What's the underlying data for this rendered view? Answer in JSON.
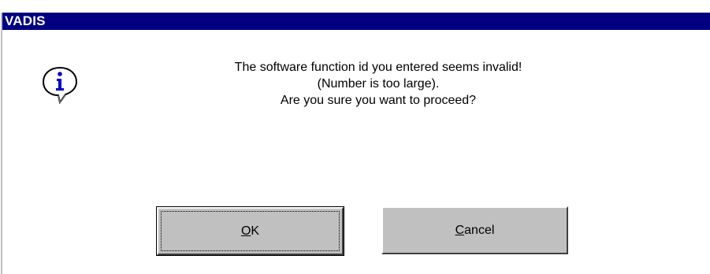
{
  "window": {
    "title": "VADIS"
  },
  "message": {
    "line1": "The software function id you entered seems invalid!",
    "line2": "(Number is too large).",
    "line3": "Are you sure you want to proceed?"
  },
  "icon": {
    "name": "info-icon",
    "glyph": "i",
    "color": "#0000c0"
  },
  "buttons": {
    "ok": {
      "accel": "O",
      "rest": "K"
    },
    "cancel": {
      "accel": "C",
      "rest": "ancel"
    }
  },
  "colors": {
    "titlebar": "#000080",
    "button_face": "#c0c0c0"
  }
}
